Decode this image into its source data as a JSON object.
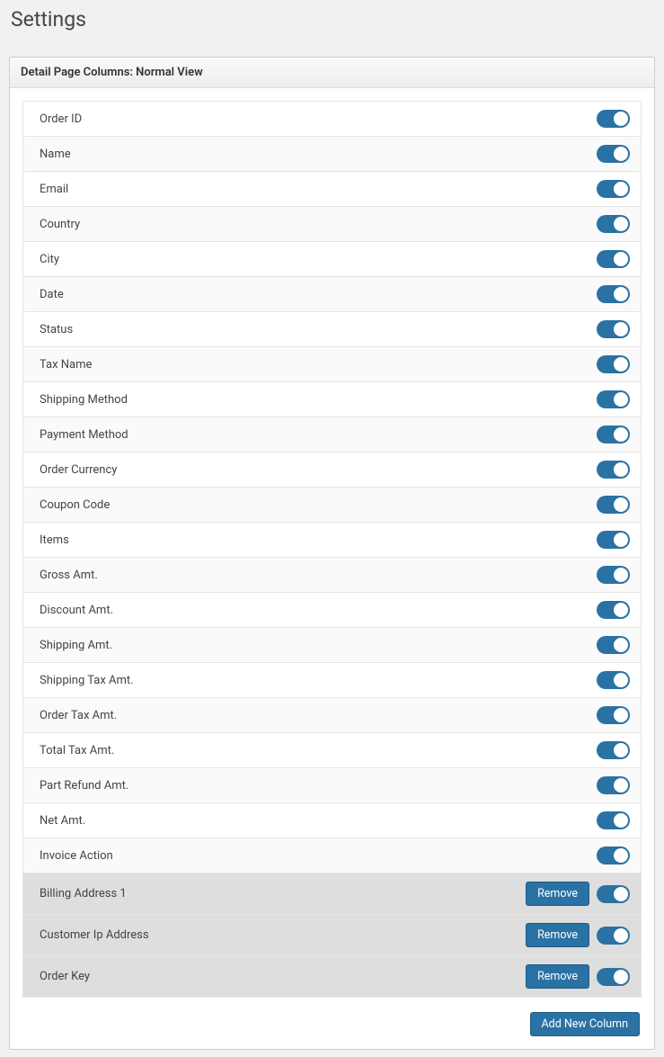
{
  "page_title": "Settings",
  "panel_title": "Detail Page Columns: Normal View",
  "columns": [
    {
      "label": "Order ID",
      "enabled": true,
      "custom": false
    },
    {
      "label": "Name",
      "enabled": true,
      "custom": false
    },
    {
      "label": "Email",
      "enabled": true,
      "custom": false
    },
    {
      "label": "Country",
      "enabled": true,
      "custom": false
    },
    {
      "label": "City",
      "enabled": true,
      "custom": false
    },
    {
      "label": "Date",
      "enabled": true,
      "custom": false
    },
    {
      "label": "Status",
      "enabled": true,
      "custom": false
    },
    {
      "label": "Tax Name",
      "enabled": true,
      "custom": false
    },
    {
      "label": "Shipping Method",
      "enabled": true,
      "custom": false
    },
    {
      "label": "Payment Method",
      "enabled": true,
      "custom": false
    },
    {
      "label": "Order Currency",
      "enabled": true,
      "custom": false
    },
    {
      "label": "Coupon Code",
      "enabled": true,
      "custom": false
    },
    {
      "label": "Items",
      "enabled": true,
      "custom": false
    },
    {
      "label": "Gross Amt.",
      "enabled": true,
      "custom": false
    },
    {
      "label": "Discount Amt.",
      "enabled": true,
      "custom": false
    },
    {
      "label": "Shipping Amt.",
      "enabled": true,
      "custom": false
    },
    {
      "label": "Shipping Tax Amt.",
      "enabled": true,
      "custom": false
    },
    {
      "label": "Order Tax Amt.",
      "enabled": true,
      "custom": false
    },
    {
      "label": "Total Tax Amt.",
      "enabled": true,
      "custom": false
    },
    {
      "label": "Part Refund Amt.",
      "enabled": true,
      "custom": false
    },
    {
      "label": "Net Amt.",
      "enabled": true,
      "custom": false
    },
    {
      "label": "Invoice Action",
      "enabled": true,
      "custom": false
    },
    {
      "label": "Billing Address 1",
      "enabled": true,
      "custom": true
    },
    {
      "label": "Customer Ip Address",
      "enabled": true,
      "custom": true
    },
    {
      "label": "Order Key",
      "enabled": true,
      "custom": true
    }
  ],
  "remove_label": "Remove",
  "add_column_label": "Add New Column"
}
